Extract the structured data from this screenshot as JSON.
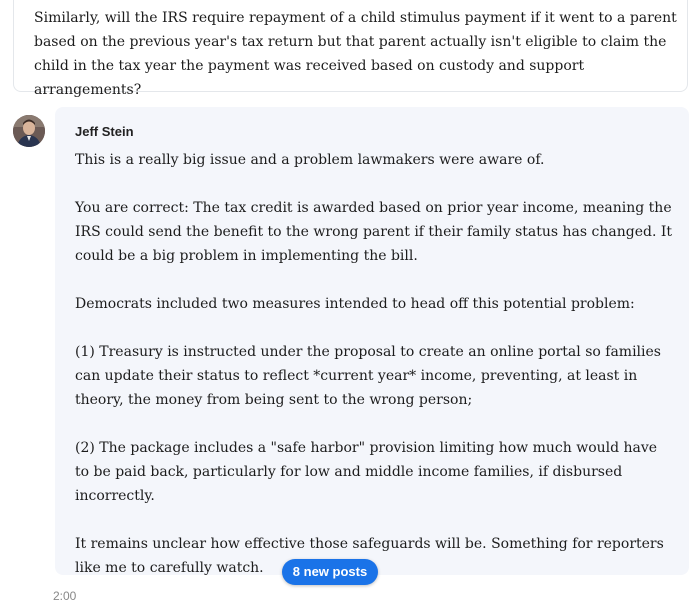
{
  "question": {
    "text": "Similarly, will the IRS require repayment of a child stimulus payment if it went to a parent based on the previous year's tax return but that parent actually isn't eligible to claim the child in the tax year the payment was received based on custody and support arrangements?"
  },
  "answer": {
    "author": "Jeff Stein",
    "paragraphs": [
      "This is a really big issue and a problem lawmakers were aware of.",
      "You are correct: The tax credit is awarded based on prior year income, meaning the IRS could send the benefit to the wrong parent if their family status has changed. It could be a big problem in implementing the bill.",
      "Democrats included two measures intended to head off this potential problem:",
      "(1) Treasury is instructed under the proposal to create an online portal so families can update their status to reflect *current year* income, preventing, at least in theory, the money from being sent to the wrong person;",
      "(2) The package includes a \"safe harbor\" provision limiting how much would have to be paid back, particularly for low and middle income families, if disbursed incorrectly.",
      "It remains unclear how effective those safeguards will be. Something for reporters like me to carefully watch."
    ]
  },
  "new_posts_label": "8 new posts",
  "footer_partial": "2:00",
  "colors": {
    "answer_background": "#f4f6fb",
    "pill_background": "#1a73e8"
  }
}
